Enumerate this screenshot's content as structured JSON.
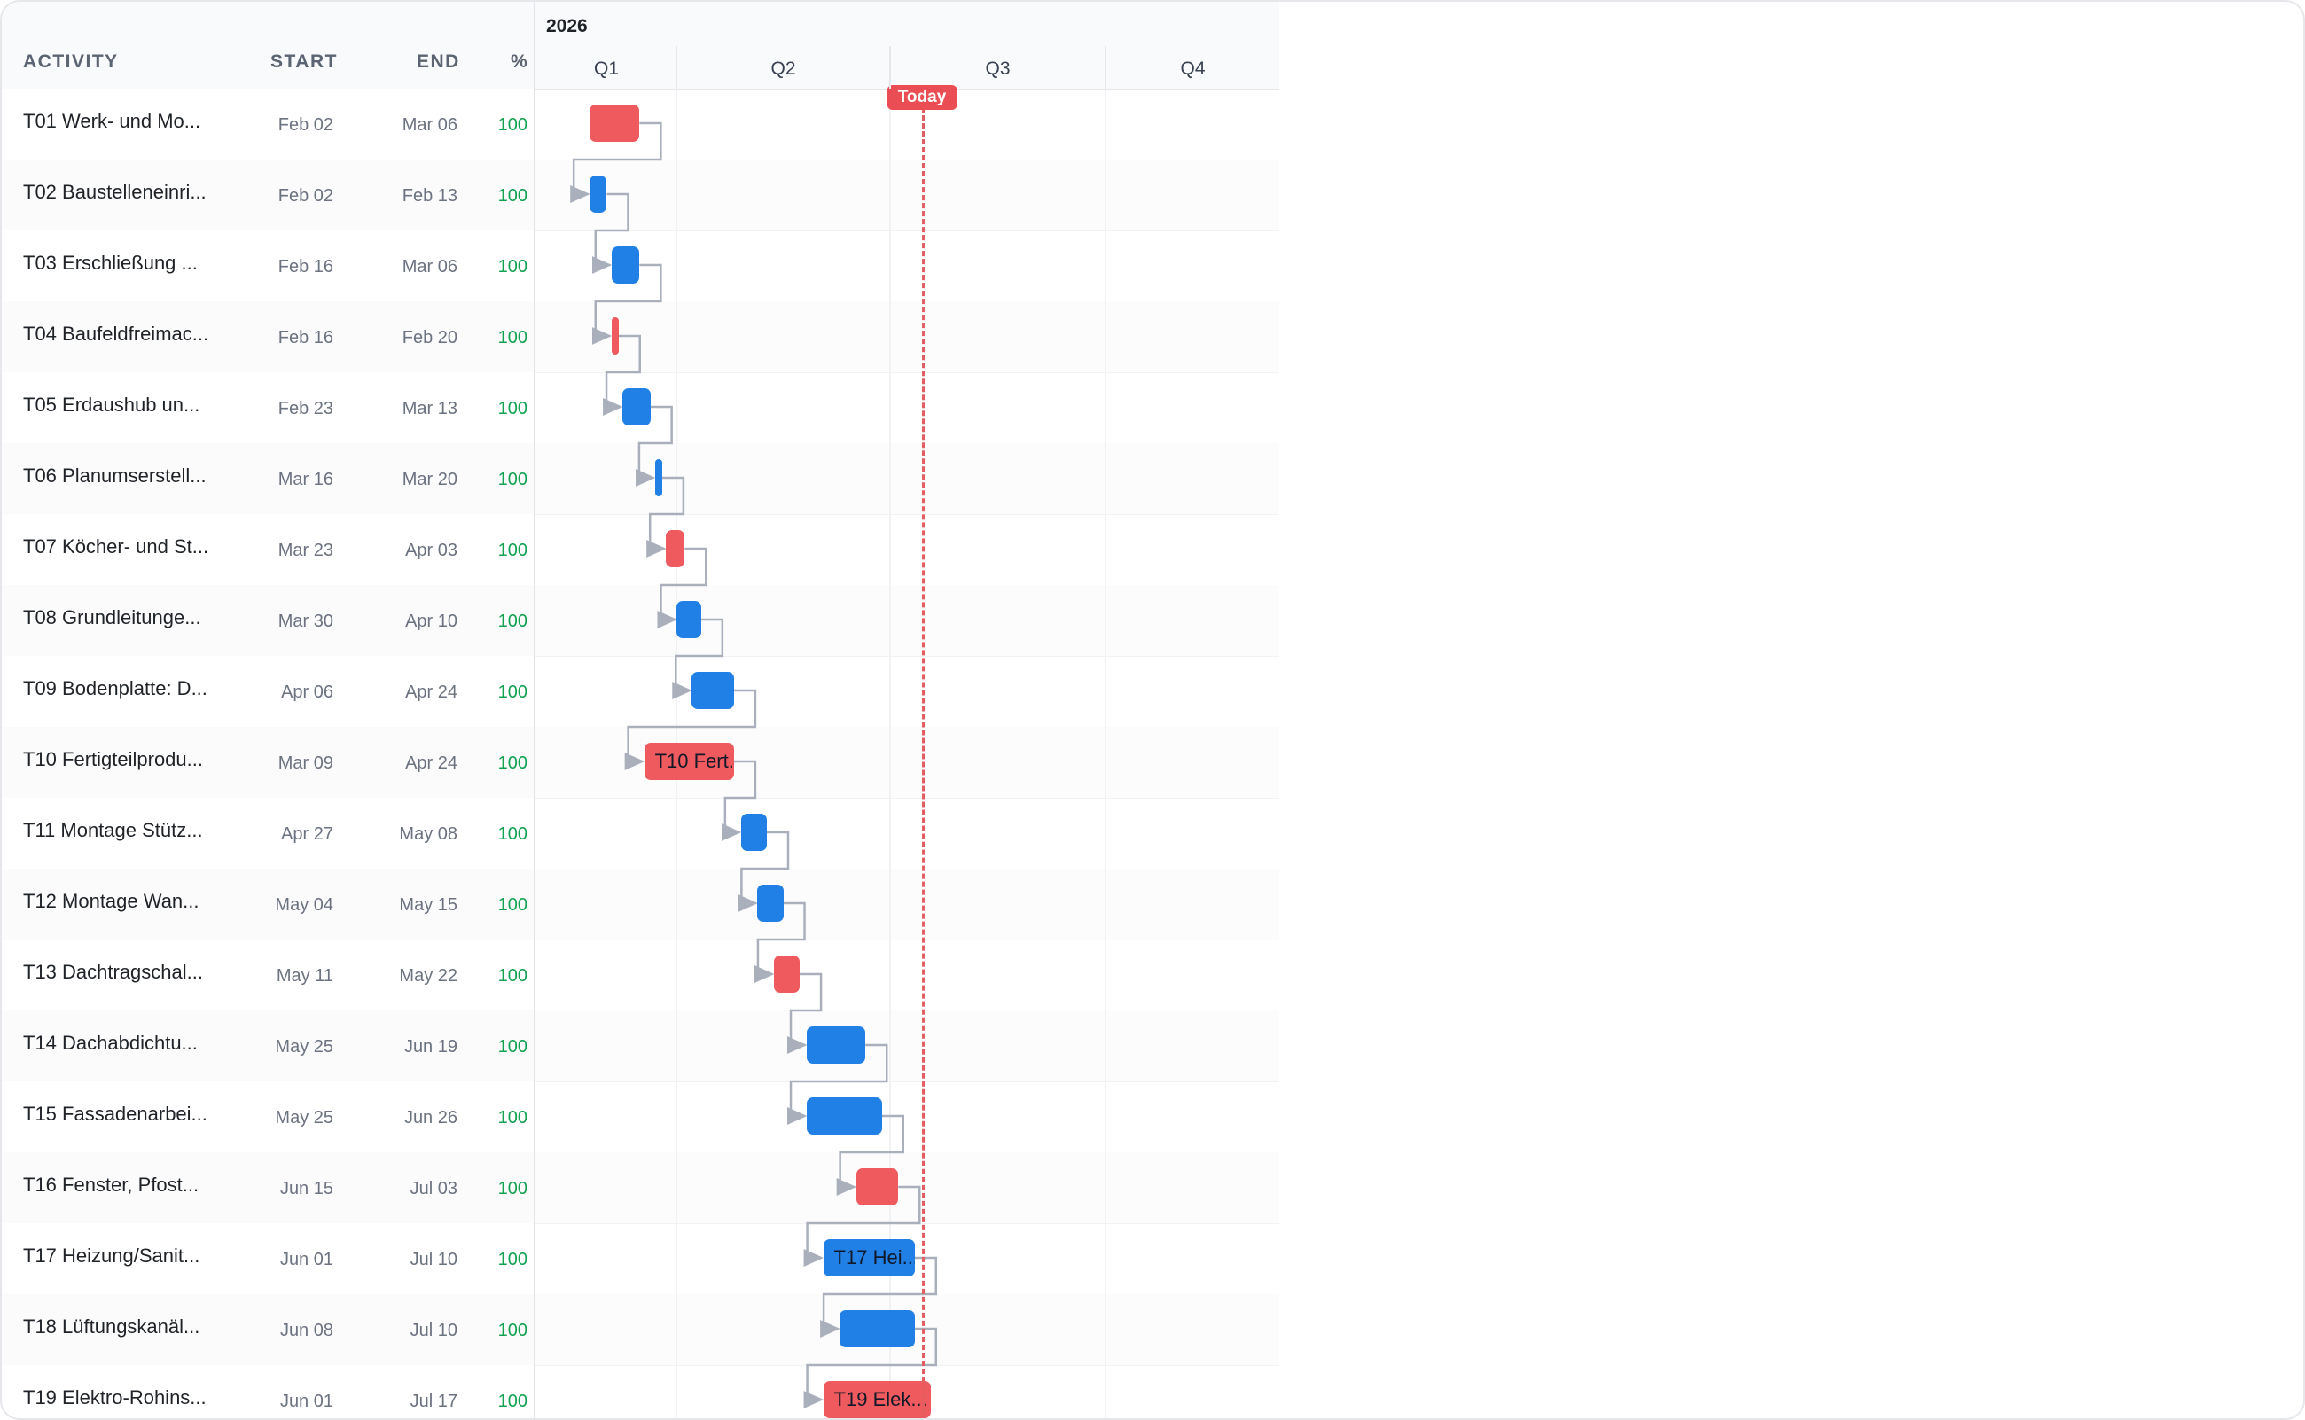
{
  "timeline": {
    "year": "2026",
    "quarters": [
      "Q1",
      "Q2",
      "Q3",
      "Q4"
    ],
    "today_label": "Today",
    "today_date": "2026-07-01"
  },
  "columns": {
    "activity": "ACTIVITY",
    "start": "START",
    "end": "END",
    "pct": "%"
  },
  "colors": {
    "critical": "#ef5a5f",
    "normal": "#2180e6",
    "today": "#ea4e54",
    "complete": "#12a150"
  },
  "tasks": [
    {
      "name": "T01 Werk- und Mo...",
      "start": "Feb 02",
      "end": "Mar 06",
      "pct": "100",
      "start_date": "2026-02-02",
      "end_date": "2026-03-06",
      "critical": true,
      "bar_label": ""
    },
    {
      "name": "T02 Baustelleneinri...",
      "start": "Feb 02",
      "end": "Feb 13",
      "pct": "100",
      "start_date": "2026-02-02",
      "end_date": "2026-02-13",
      "critical": false,
      "bar_label": ""
    },
    {
      "name": "T03 Erschließung ...",
      "start": "Feb 16",
      "end": "Mar 06",
      "pct": "100",
      "start_date": "2026-02-16",
      "end_date": "2026-03-06",
      "critical": false,
      "bar_label": ""
    },
    {
      "name": "T04 Baufeldfreimac...",
      "start": "Feb 16",
      "end": "Feb 20",
      "pct": "100",
      "start_date": "2026-02-16",
      "end_date": "2026-02-20",
      "critical": true,
      "bar_label": ""
    },
    {
      "name": "T05 Erdaushub un...",
      "start": "Feb 23",
      "end": "Mar 13",
      "pct": "100",
      "start_date": "2026-02-23",
      "end_date": "2026-03-13",
      "critical": false,
      "bar_label": ""
    },
    {
      "name": "T06 Planumserstell...",
      "start": "Mar 16",
      "end": "Mar 20",
      "pct": "100",
      "start_date": "2026-03-16",
      "end_date": "2026-03-20",
      "critical": false,
      "bar_label": ""
    },
    {
      "name": "T07 Köcher- und St...",
      "start": "Mar 23",
      "end": "Apr 03",
      "pct": "100",
      "start_date": "2026-03-23",
      "end_date": "2026-04-03",
      "critical": true,
      "bar_label": ""
    },
    {
      "name": "T08 Grundleitunge...",
      "start": "Mar 30",
      "end": "Apr 10",
      "pct": "100",
      "start_date": "2026-03-30",
      "end_date": "2026-04-10",
      "critical": false,
      "bar_label": ""
    },
    {
      "name": "T09 Bodenplatte: D...",
      "start": "Apr 06",
      "end": "Apr 24",
      "pct": "100",
      "start_date": "2026-04-06",
      "end_date": "2026-04-24",
      "critical": false,
      "bar_label": ""
    },
    {
      "name": "T10 Fertigteilprodu...",
      "start": "Mar 09",
      "end": "Apr 24",
      "pct": "100",
      "start_date": "2026-03-09",
      "end_date": "2026-04-24",
      "critical": true,
      "bar_label": "T10 Fert..."
    },
    {
      "name": "T11 Montage Stütz...",
      "start": "Apr 27",
      "end": "May 08",
      "pct": "100",
      "start_date": "2026-04-27",
      "end_date": "2026-05-08",
      "critical": false,
      "bar_label": ""
    },
    {
      "name": "T12 Montage Wan...",
      "start": "May 04",
      "end": "May 15",
      "pct": "100",
      "start_date": "2026-05-04",
      "end_date": "2026-05-15",
      "critical": false,
      "bar_label": ""
    },
    {
      "name": "T13 Dachtragschal...",
      "start": "May 11",
      "end": "May 22",
      "pct": "100",
      "start_date": "2026-05-11",
      "end_date": "2026-05-22",
      "critical": true,
      "bar_label": ""
    },
    {
      "name": "T14 Dachabdichtu...",
      "start": "May 25",
      "end": "Jun 19",
      "pct": "100",
      "start_date": "2026-05-25",
      "end_date": "2026-06-19",
      "critical": false,
      "bar_label": ""
    },
    {
      "name": "T15 Fassadenarbei...",
      "start": "May 25",
      "end": "Jun 26",
      "pct": "100",
      "start_date": "2026-05-25",
      "end_date": "2026-06-26",
      "critical": false,
      "bar_label": ""
    },
    {
      "name": "T16 Fenster, Pfost...",
      "start": "Jun 15",
      "end": "Jul 03",
      "pct": "100",
      "start_date": "2026-06-15",
      "end_date": "2026-07-03",
      "critical": true,
      "bar_label": ""
    },
    {
      "name": "T17 Heizung/Sanit...",
      "start": "Jun 01",
      "end": "Jul 10",
      "pct": "100",
      "start_date": "2026-06-01",
      "end_date": "2026-07-10",
      "critical": false,
      "bar_label": "T17 Hei..."
    },
    {
      "name": "T18 Lüftungskanäl...",
      "start": "Jun 08",
      "end": "Jul 10",
      "pct": "100",
      "start_date": "2026-06-08",
      "end_date": "2026-07-10",
      "critical": false,
      "bar_label": ""
    },
    {
      "name": "T19 Elektro-Rohins...",
      "start": "Jun 01",
      "end": "Jul 17",
      "pct": "100",
      "start_date": "2026-06-01",
      "end_date": "2026-07-17",
      "critical": true,
      "bar_label": "T19 Elek..."
    }
  ]
}
